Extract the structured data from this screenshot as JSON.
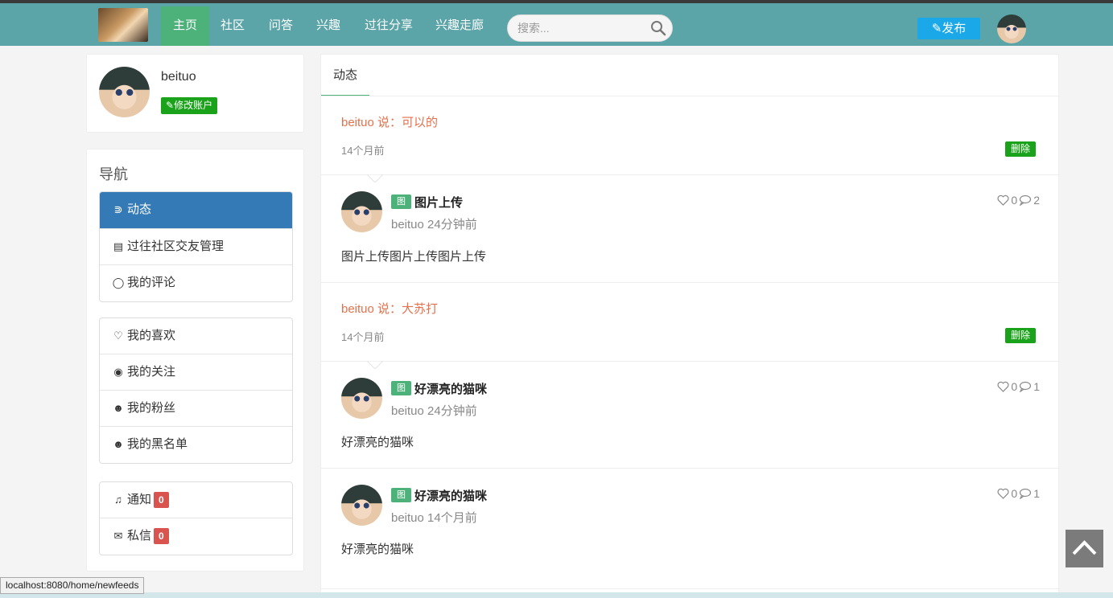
{
  "nav": {
    "items": [
      {
        "label": "主页",
        "active": true
      },
      {
        "label": "社区",
        "active": false
      },
      {
        "label": "问答",
        "active": false
      },
      {
        "label": "兴趣",
        "active": false
      },
      {
        "label": "过往分享",
        "active": false
      },
      {
        "label": "兴趣走廊",
        "active": false
      }
    ],
    "search_placeholder": "搜索...",
    "publish_label": "发布"
  },
  "profile": {
    "username": "beituo",
    "edit_label": "修改账户"
  },
  "sidebar": {
    "heading": "导航",
    "group1": [
      {
        "label": "动态",
        "icon": "rss-icon",
        "active": true
      },
      {
        "label": "过往社区交友管理",
        "icon": "document-icon"
      },
      {
        "label": "我的评论",
        "icon": "comment-icon"
      }
    ],
    "group2": [
      {
        "label": "我的喜欢",
        "icon": "heart-icon"
      },
      {
        "label": "我的关注",
        "icon": "eye-icon"
      },
      {
        "label": "我的粉丝",
        "icon": "users-icon"
      },
      {
        "label": "我的黑名单",
        "icon": "users-icon"
      }
    ],
    "group3": [
      {
        "label": "通知",
        "icon": "bell-icon",
        "count": "0"
      },
      {
        "label": "私信",
        "icon": "envelope-icon",
        "count": "0"
      }
    ]
  },
  "main": {
    "tab_label": "动态",
    "feed": [
      {
        "type": "comment",
        "text": "beituo 说：可以的",
        "time": "14个月前",
        "delete_label": "删除"
      },
      {
        "type": "post",
        "tag": "图",
        "title": "图片上传",
        "meta": "beituo 24分钟前",
        "body": "图片上传图片上传图片上传",
        "likes": "0",
        "comments": "2"
      },
      {
        "type": "comment",
        "text": "beituo 说：大苏打",
        "time": "14个月前",
        "delete_label": "删除"
      },
      {
        "type": "post",
        "tag": "图",
        "title": "好漂亮的猫咪",
        "meta": "beituo 24分钟前",
        "body": "好漂亮的猫咪",
        "likes": "0",
        "comments": "1"
      },
      {
        "type": "post",
        "tag": "图",
        "title": "好漂亮的猫咪",
        "meta": "beituo  14个月前",
        "body": "好漂亮的猫咪",
        "likes": "0",
        "comments": "1"
      }
    ]
  },
  "status_url": "localhost:8080/home/newfeeds",
  "colors": {
    "topbar": "#5ba4a8",
    "nav_active": "#4cb27a",
    "publish": "#1aa8e8",
    "sidebar_active": "#337ab7",
    "danger": "#d9534f",
    "success": "#1ba21b",
    "comment_text": "#e5704b"
  }
}
